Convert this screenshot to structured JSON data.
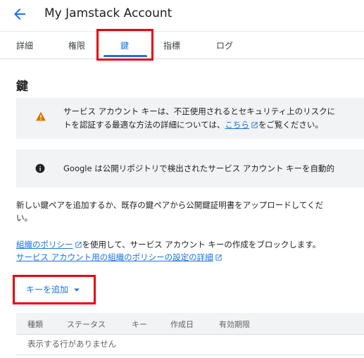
{
  "header": {
    "title": "My Jamstack Account"
  },
  "tabs": [
    {
      "label": "詳細"
    },
    {
      "label": "権限"
    },
    {
      "label": "鍵"
    },
    {
      "label": "指標"
    },
    {
      "label": "ログ"
    }
  ],
  "section": {
    "title": "鍵"
  },
  "warning_banner": {
    "line1": "サービス アカウント キーは、不正使用されるとセキュリティ上のリスクに",
    "line2_before": "トを認証する最適な方法の詳細については、",
    "line2_link": "こちら",
    "line2_after": "をご覧ください。"
  },
  "info_banner": {
    "text": "Google は公開リポジトリで検出されたサービス アカウント キーを自動的"
  },
  "description": {
    "line1": "新しい鍵ペアを追加するか、既存の鍵ペアから公開鍵証明書をアップロードしてくだ",
    "line2": "い。"
  },
  "policy": {
    "link1": "組織のポリシー",
    "text1": "を使用して、サービス アカウント キーの作成をブロックします。",
    "link2": "サービス アカウント用の組織のポリシーの設定の詳細"
  },
  "add_key_button": {
    "label": "キーを追加"
  },
  "table": {
    "columns": [
      "種類",
      "ステータス",
      "キー",
      "作成日",
      "有効期限"
    ],
    "empty_message": "表示する行がありません"
  },
  "colors": {
    "accent": "#1a73e8",
    "highlight": "#e8000f",
    "warning": "#e37400"
  }
}
